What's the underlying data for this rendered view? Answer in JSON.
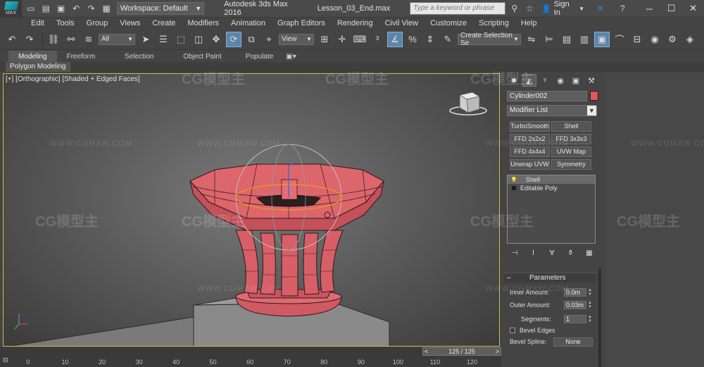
{
  "titlebar": {
    "workspace_label": "Workspace: Default",
    "app_title": "Autodesk 3ds Max 2016",
    "file_title": "Lesson_03_End.max",
    "search_placeholder": "Type a keyword or phrase",
    "signin_label": "Sign In",
    "logo_text": "MAX"
  },
  "menu": [
    "Edit",
    "Tools",
    "Group",
    "Views",
    "Create",
    "Modifiers",
    "Animation",
    "Graph Editors",
    "Rendering",
    "Civil View",
    "Customize",
    "Scripting",
    "Help"
  ],
  "toolbar": {
    "filter_value": "All",
    "refcoord_value": "View",
    "selection_set_placeholder": "Create Selection Se"
  },
  "ribbon": {
    "tabs": [
      "Modeling",
      "Freeform",
      "Selection",
      "Object Paint",
      "Populate"
    ],
    "active_tab": "Modeling",
    "sub_label": "Polygon Modeling"
  },
  "viewport": {
    "label": "[+] [Orthographic] [Shaded + Edged Faces]"
  },
  "command_panel": {
    "object_name": "Cylinder002",
    "object_color": "#e05656",
    "modifier_list_label": "Modifier List",
    "modifier_buttons": [
      "TurboSmooth",
      "Shell",
      "FFD 2x2x2",
      "FFD 3x3x3",
      "FFD 4x4x4",
      "UVW Map",
      "Unwrap UVW",
      "Symmetry"
    ],
    "stack": [
      {
        "label": "Shell",
        "selected": true
      },
      {
        "label": "Editable Poly",
        "selected": false
      }
    ],
    "parameters": {
      "header": "Parameters",
      "inner_amount_label": "Inner Amount:",
      "inner_amount_value": "0.0m",
      "outer_amount_label": "Outer Amount:",
      "outer_amount_value": "0.03m",
      "segments_label": "Segments:",
      "segments_value": "1",
      "bevel_edges_label": "Bevel Edges",
      "bevel_spline_label": "Bevel Spline:",
      "bevel_spline_value": "None"
    }
  },
  "timeline": {
    "frame_display": "125 / 125",
    "ticks": [
      "0",
      "10",
      "20",
      "30",
      "40",
      "50",
      "60",
      "70",
      "80",
      "90",
      "100",
      "110",
      "120"
    ]
  },
  "watermark": {
    "brand": "CG模型主",
    "url": "WWW.CGMXW.COM"
  }
}
